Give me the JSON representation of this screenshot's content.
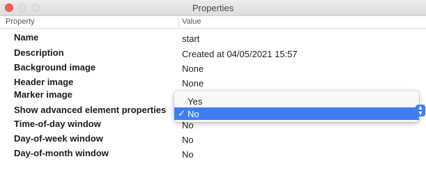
{
  "window": {
    "title": "Properties"
  },
  "columns": {
    "property": "Property",
    "value": "Value"
  },
  "rows": [
    {
      "property": "Name",
      "value": "start"
    },
    {
      "property": "Description",
      "value": "Created at 04/05/2021 15:57"
    },
    {
      "property": "Background image",
      "value": "None"
    },
    {
      "property": "Header image",
      "value": "None"
    },
    {
      "property": "Marker image",
      "value": ""
    },
    {
      "property": "Show advanced element properties",
      "value": "No"
    },
    {
      "property": "Time-of-day window",
      "value": "No"
    },
    {
      "property": "Day-of-week window",
      "value": "No"
    },
    {
      "property": "Day-of-month window",
      "value": "No"
    }
  ],
  "dropdown": {
    "options": [
      {
        "label": "Yes",
        "selected": false
      },
      {
        "label": "No",
        "selected": true
      }
    ],
    "checkmark": "✓",
    "accent_color": "#3f7ef2"
  },
  "icons": {
    "close": "close-icon",
    "minimize": "minimize-icon",
    "zoom": "zoom-icon",
    "stepper": "chevron-up-down-icon"
  }
}
